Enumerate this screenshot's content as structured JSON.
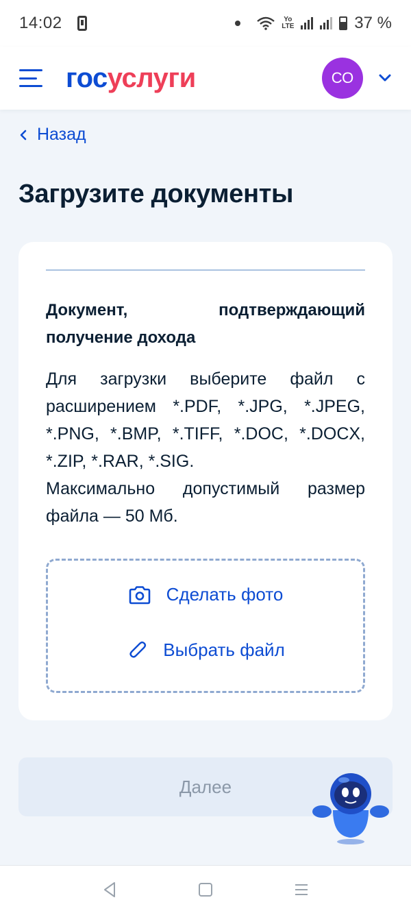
{
  "status_bar": {
    "time": "14:02",
    "battery_percent": "37 %",
    "volte_label_top": "Yo",
    "volte_label_bottom": "LTE"
  },
  "header": {
    "logo_part1": "гос",
    "logo_part2": "услуги",
    "avatar_initials": "СО",
    "brand_color": "#0d4cd3",
    "logo_accent_color": "#ee3f58",
    "avatar_color": "#9a32e0"
  },
  "back_link": {
    "label": "Назад"
  },
  "page_title": "Загрузите документы",
  "card": {
    "doc_title": "Документ, подтверждающий получение дохода",
    "description_line1": "Для загрузки выберите файл с расширением *.PDF, *.JPG, *.JPEG, *.PNG, *.BMP, *.TIFF, *.DOC, *.DOCX, *.ZIP, *.RAR, *.SIG.",
    "description_line2": "Максимально допустимый размер файла — 50 Мб.",
    "upload": {
      "take_photo_label": "Сделать фото",
      "choose_file_label": "Выбрать файл"
    }
  },
  "next_button": {
    "label": "Далее",
    "enabled": false
  },
  "icons": {
    "menu": "menu-icon",
    "chevron_down": "chevron-down-icon",
    "back": "chevron-left-icon",
    "camera": "camera-icon",
    "paperclip": "paperclip-icon",
    "assistant": "robot-assistant-icon",
    "nav_back": "triangle-back-icon",
    "nav_home": "square-home-icon",
    "nav_menu": "lines-menu-icon"
  }
}
